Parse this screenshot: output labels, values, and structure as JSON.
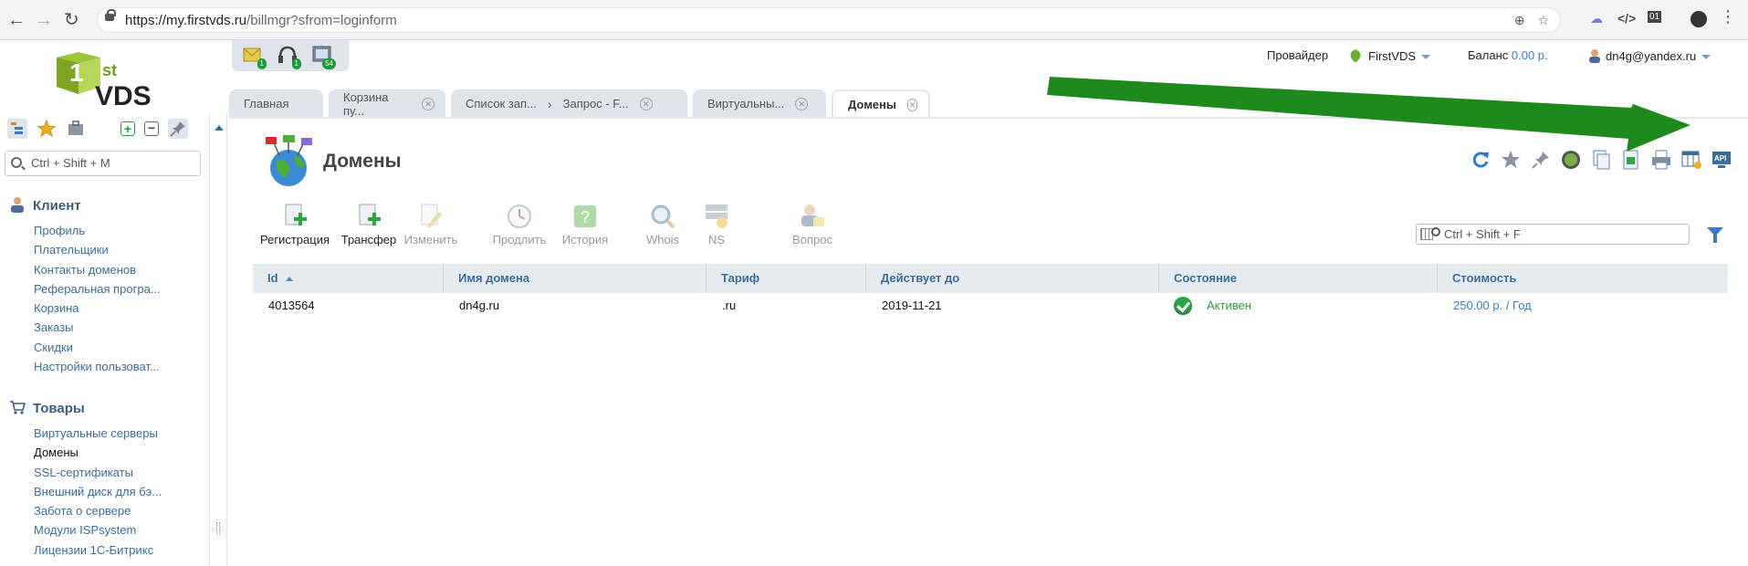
{
  "browser": {
    "url_host": "https://my.firstvds.ru",
    "url_path": "/billmgr?sfrom=loginform"
  },
  "header": {
    "provider_label": "Провайдер",
    "provider_name": "FirstVDS",
    "balance_label": "Баланс",
    "balance_value": "0.00 р.",
    "user": "dn4g@yandex.ru",
    "mini_badges": [
      "1",
      "1",
      "54"
    ]
  },
  "logo": {
    "sup": "st",
    "text": "VDS"
  },
  "tabs": [
    {
      "label": "Главная"
    },
    {
      "label": "Корзина пу..."
    },
    {
      "label": "Список зап..."
    },
    {
      "label": "Запрос - F..."
    },
    {
      "label": "Виртуальны..."
    },
    {
      "label": "Домены"
    }
  ],
  "sidebar": {
    "search_placeholder": "Ctrl + Shift + M",
    "section_client": "Клиент",
    "client_items": [
      "Профиль",
      "Плательщики",
      "Контакты доменов",
      "Реферальная програ...",
      "Корзина",
      "Заказы",
      "Скидки",
      "Настройки пользоват..."
    ],
    "section_goods": "Товары",
    "goods_items": [
      "Виртуальные серверы",
      "Домены",
      "SSL-сертификаты",
      "Внешний диск для бэ...",
      "Забота о сервере",
      "Модули ISPsystem",
      "Лицензии 1С-Битрикс"
    ]
  },
  "main": {
    "title": "Домены",
    "actions": {
      "register": "Регистрация",
      "transfer": "Трансфер",
      "edit": "Изменить",
      "renew": "Продлить",
      "history": "История",
      "whois": "Whois",
      "ns": "NS",
      "question": "Вопрос"
    },
    "table_search_placeholder": "Ctrl + Shift + F",
    "columns": [
      "Id",
      "Имя домена",
      "Тариф",
      "Действует до",
      "Состояние",
      "Стоимость"
    ],
    "rows": [
      {
        "id": "4013564",
        "domain": "dn4g.ru",
        "tariff": ".ru",
        "valid_until": "2019-11-21",
        "status": "Активен",
        "price": "250.00 р. / Год"
      }
    ]
  },
  "colors": {
    "accent": "#3a7dc4",
    "ok": "#2a9a3a",
    "arrow": "#1e8a1e",
    "header_bg": "#e6ebf0"
  }
}
